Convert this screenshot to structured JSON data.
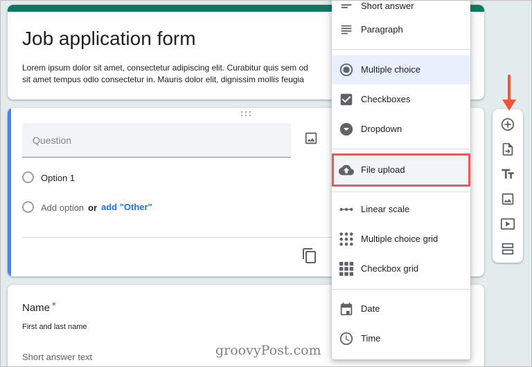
{
  "form": {
    "title": "Job application form",
    "description_line1": "Lorem ipsum dolor sit amet, consectetur adipiscing elit. Curabitur quis sem od",
    "description_line2": "sit amet tempus odio consectetur in. Mauris dolor elit, dignissim mollis feugia"
  },
  "question": {
    "placeholder": "Question",
    "option1": "Option 1",
    "add_option": "Add option",
    "or": "or",
    "add_other": "add \"Other\""
  },
  "name_question": {
    "title": "Name",
    "required_mark": "*",
    "description": "First and last name",
    "answer_placeholder": "Short answer text"
  },
  "type_menu": {
    "items": [
      {
        "label": "Short answer",
        "icon": "short-answer-icon"
      },
      {
        "label": "Paragraph",
        "icon": "paragraph-icon"
      },
      {
        "label": "Multiple choice",
        "icon": "radio-button-icon",
        "selected": true
      },
      {
        "label": "Checkboxes",
        "icon": "checkbox-icon"
      },
      {
        "label": "Dropdown",
        "icon": "dropdown-icon"
      },
      {
        "label": "File upload",
        "icon": "cloud-upload-icon",
        "highlighted": true
      },
      {
        "label": "Linear scale",
        "icon": "linear-scale-icon"
      },
      {
        "label": "Multiple choice grid",
        "icon": "grid-icon"
      },
      {
        "label": "Checkbox grid",
        "icon": "checkbox-grid-icon"
      },
      {
        "label": "Date",
        "icon": "calendar-icon"
      },
      {
        "label": "Time",
        "icon": "clock-icon"
      }
    ]
  },
  "toolbar": {
    "buttons": [
      "add-question-icon",
      "import-questions-icon",
      "add-title-icon",
      "add-image-icon",
      "add-video-icon",
      "add-section-icon"
    ]
  },
  "colors": {
    "theme": "#0b7a63",
    "focus_bar": "#4285f4",
    "highlight_box": "#e25c5c",
    "arrow": "#f0553c",
    "link": "#1a73e8"
  },
  "watermark": "groovyPost.com"
}
